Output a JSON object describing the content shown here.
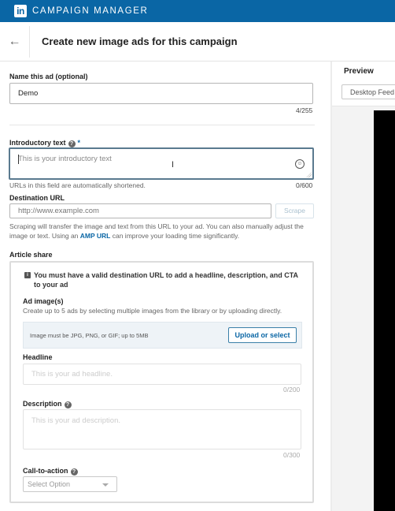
{
  "app": {
    "logo_text": "in",
    "brand": "CAMPAIGN MANAGER",
    "colors": {
      "brand": "#0a66a5",
      "link": "#0a66a5"
    }
  },
  "header": {
    "back_icon": "←",
    "title": "Create new image ads for this campaign"
  },
  "form": {
    "name": {
      "label": "Name this ad (optional)",
      "value": "Demo",
      "counter": "4/255"
    },
    "intro": {
      "label": "Introductory text",
      "help_icon": "?",
      "required_mark": "*",
      "placeholder": "This is your introductory text",
      "emoji_icon": "☺",
      "cursor_icon": "I",
      "hint": "URLs in this field are automatically shortened.",
      "counter": "0/600"
    },
    "destination": {
      "label": "Destination URL",
      "placeholder": "http://www.example.com",
      "scrape_button": "Scrape",
      "hint_before": "Scraping will transfer the image and text from this URL to your ad. You can also manually adjust the image or text. Using an",
      "hint_link": "AMP URL",
      "hint_after": "can improve your loading time significantly."
    },
    "article": {
      "label": "Article share",
      "info_icon": "i",
      "info_text": "You must have a valid destination URL to add a headline, description, and CTA to your ad",
      "images": {
        "label": "Ad image(s)",
        "hint": "Create up to 5 ads by selecting multiple images from the library or by uploading directly.",
        "requirements": "Image must be JPG, PNG, or GIF; up to 5MB",
        "upload_button": "Upload or select"
      },
      "headline": {
        "label": "Headline",
        "placeholder": "This is your ad headline.",
        "counter": "0/200"
      },
      "description": {
        "label": "Description",
        "help_icon": "?",
        "placeholder": "This is your ad description.",
        "counter": "0/300"
      },
      "cta": {
        "label": "Call-to-action",
        "help_icon": "?",
        "selected": "Select Option"
      }
    }
  },
  "preview": {
    "title": "Preview",
    "tab": "Desktop Feed"
  }
}
